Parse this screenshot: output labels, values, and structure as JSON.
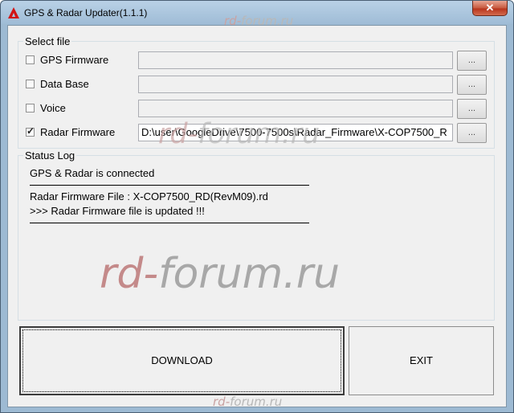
{
  "window": {
    "title": "GPS & Radar Updater(1.1.1)",
    "close_label": "✕"
  },
  "select_file": {
    "label": "Select file",
    "rows": [
      {
        "label": "GPS Firmware",
        "checked": false,
        "path": "",
        "browse": "..."
      },
      {
        "label": "Data Base",
        "checked": false,
        "path": "",
        "browse": "..."
      },
      {
        "label": "Voice",
        "checked": false,
        "path": "",
        "browse": "..."
      },
      {
        "label": "Radar Firmware",
        "checked": true,
        "path": "D:\\user\\GoogleDrive\\7500-7500s\\Radar_Firmware\\X-COP7500_R",
        "browse": "..."
      }
    ]
  },
  "status_log": {
    "label": "Status Log",
    "lines": [
      "GPS & Radar is connected",
      "Radar Firmware File   : X-COP7500_RD(RevM09).rd",
      ">>> Radar Firmware file is updated !!!"
    ]
  },
  "buttons": {
    "download": "DOWNLOAD",
    "exit": "EXIT"
  },
  "watermark": {
    "prefix": "rd-",
    "suffix": "forum.ru"
  }
}
